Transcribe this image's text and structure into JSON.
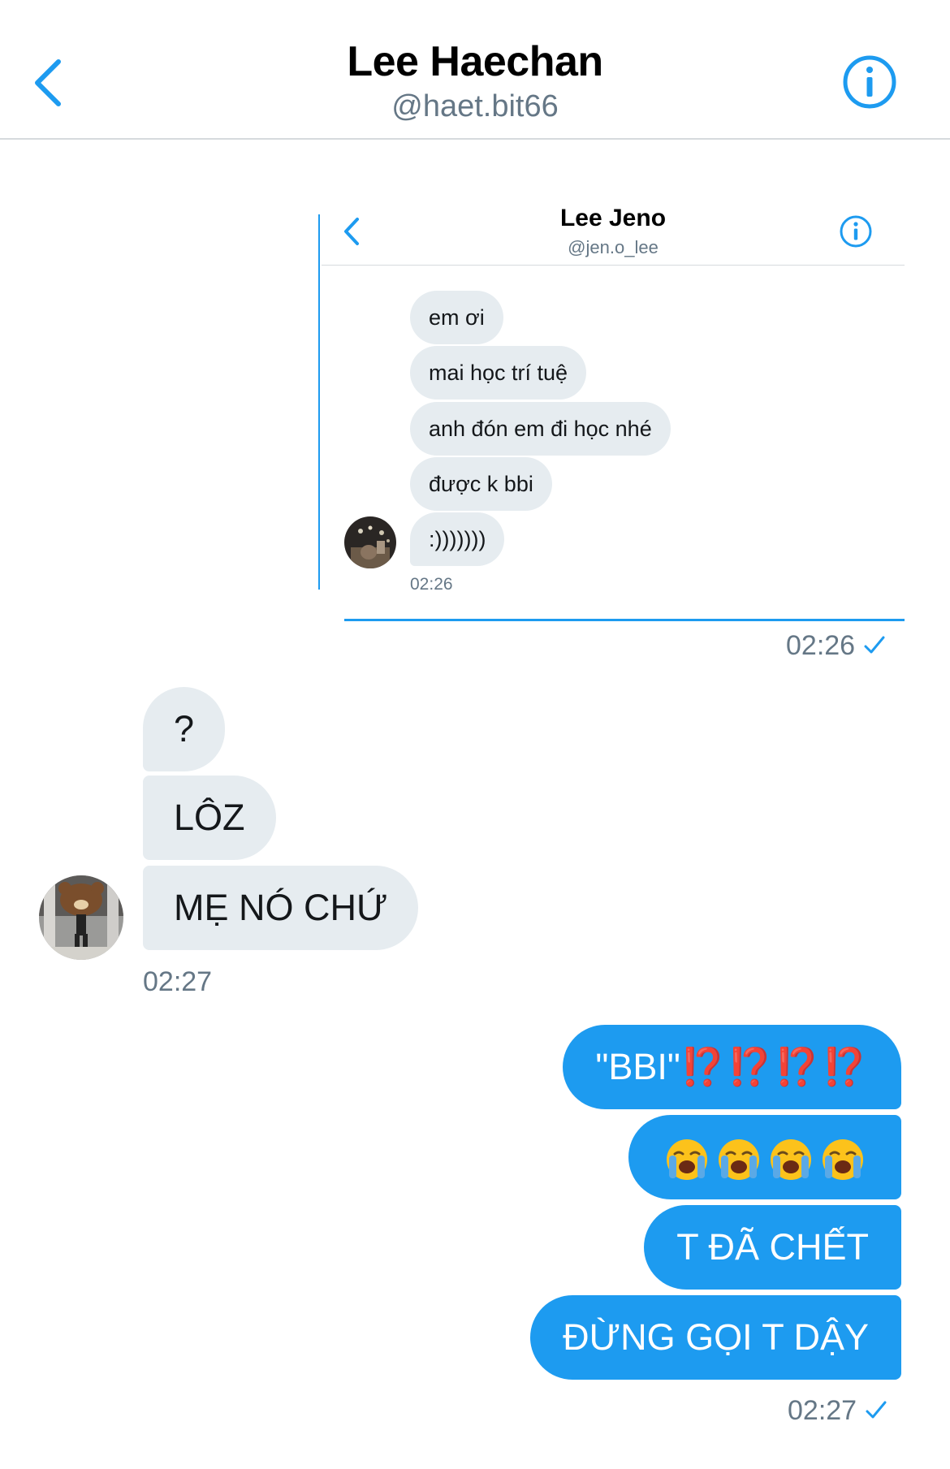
{
  "header": {
    "name": "Lee Haechan",
    "handle": "@haet.bit66"
  },
  "quoted": {
    "name": "Lee Jeno",
    "handle": "@jen.o_lee",
    "messages": [
      "em ơi",
      "mai học trí tuệ",
      "anh đón em đi học nhé",
      "được k bbi",
      ":)))))))"
    ],
    "time": "02:26"
  },
  "quoted_sent_time": "02:26",
  "received": {
    "messages": [
      "?",
      "LÔZ",
      "MẸ NÓ CHỨ"
    ],
    "time": "02:27"
  },
  "sent": {
    "bbi_text": "\"BBI\"",
    "bbi_marks": "⁉️⁉️⁉️⁉️",
    "emoji_name": "loudly-crying-face-icon",
    "emoji_count": 4,
    "dead": "T ĐÃ CHẾT",
    "dont_wake": "ĐỪNG GỌI T DẬY",
    "time": "02:27"
  },
  "colors": {
    "accent": "#1d9bf0",
    "received_bubble": "#e6ecf0",
    "secondary_text": "#657786",
    "exclamation": "#e8311f"
  }
}
